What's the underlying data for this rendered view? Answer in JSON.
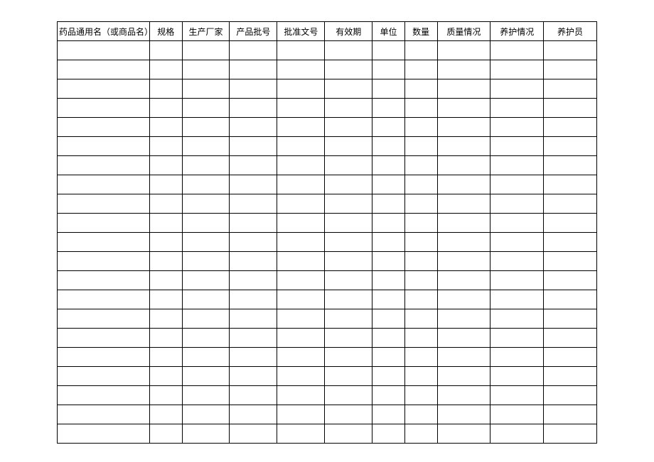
{
  "table": {
    "headers": [
      "药品通用名（或商品名）",
      "规格",
      "生产厂家",
      "产品批号",
      "批准文号",
      "有效期",
      "单位",
      "数量",
      "质量情况",
      "养护情况",
      "养护员"
    ],
    "row_count": 21
  }
}
